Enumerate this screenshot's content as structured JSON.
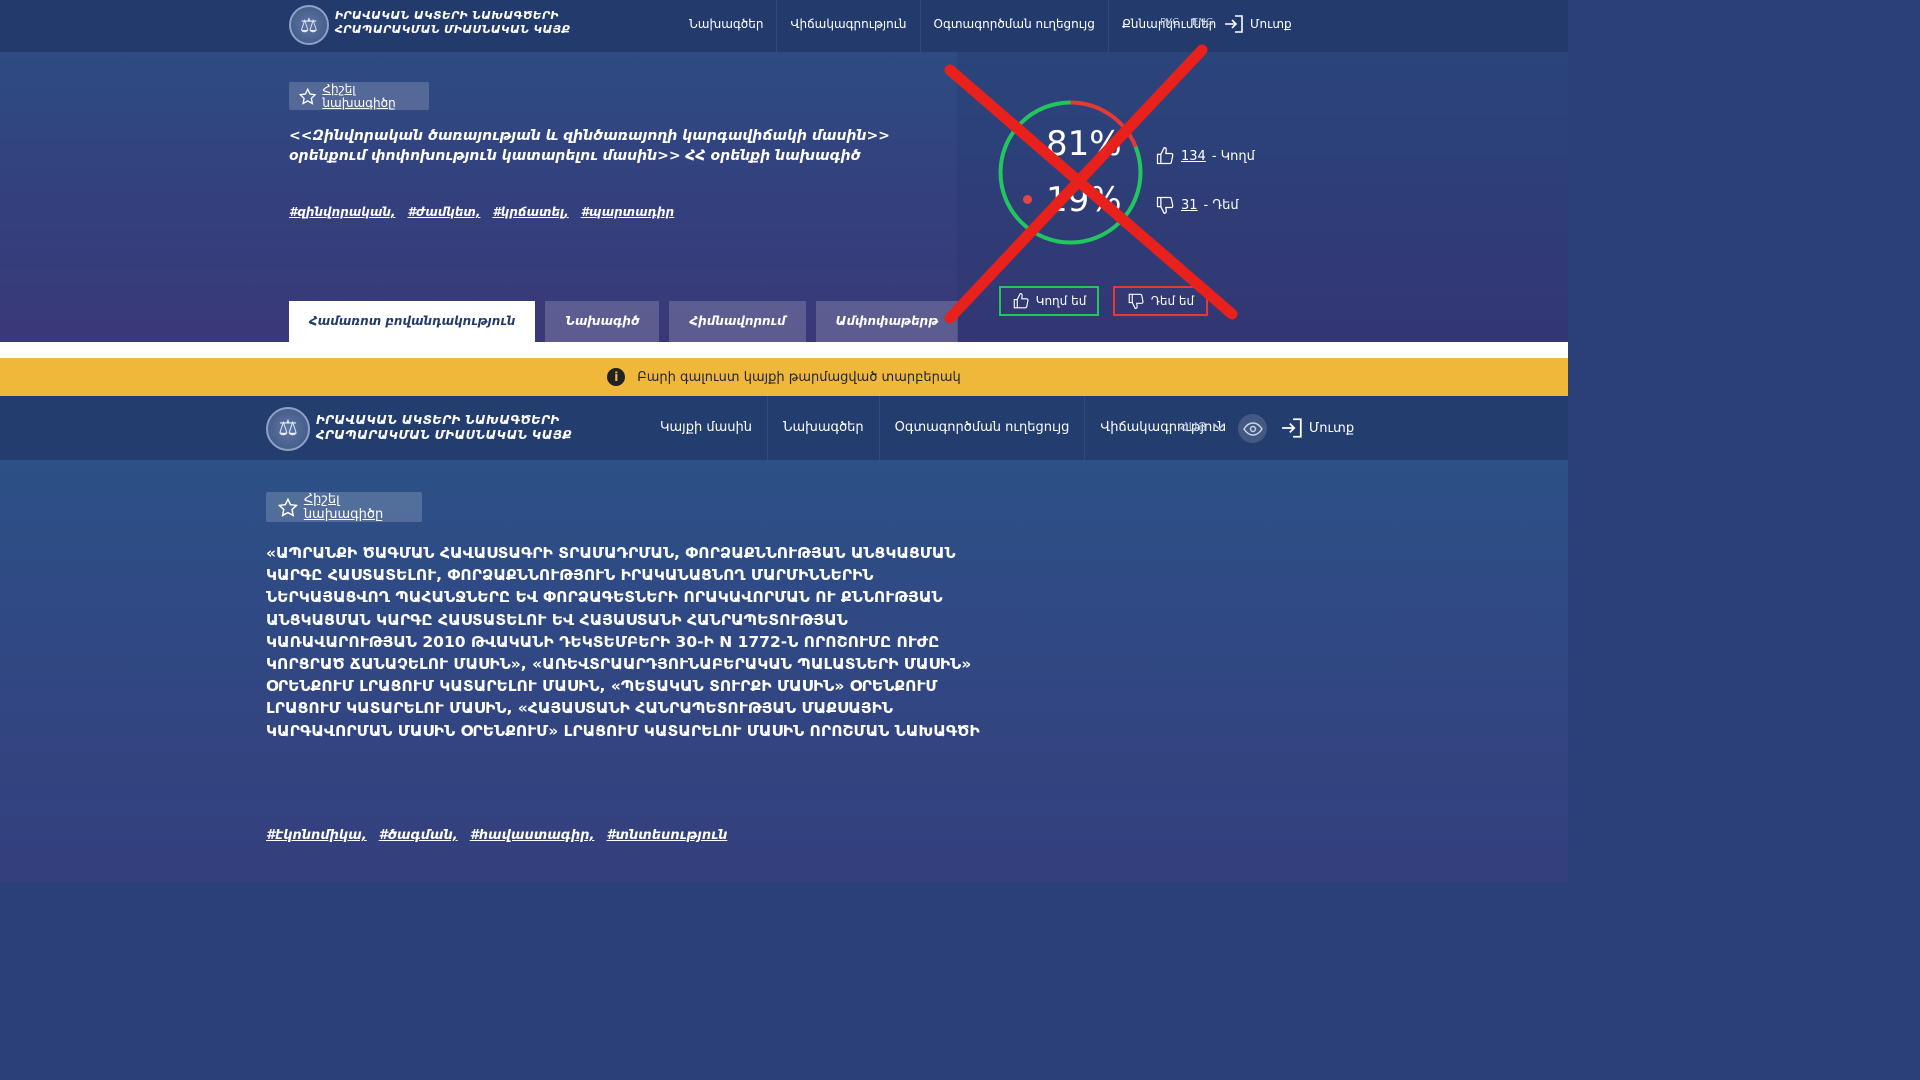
{
  "old": {
    "logo": {
      "line1": "ԻՐԱՎԱԿԱՆ ԱԿՏԵՐԻ ՆԱԽԱԳԾԵՐԻ",
      "line2": "ՀՐԱՊԱՐԱԿՄԱՆ ՄԻԱՍՆԱԿԱՆ ԿԱՅՔ"
    },
    "nav": [
      "Նախագծեր",
      "Վիճակագրություն",
      "Օգտագործման ուղեցույց",
      "Քննարկումներ"
    ],
    "lang": [
      "РУС",
      "ENG"
    ],
    "login": "Մուտք",
    "remember": "Հիշել նախագիծը",
    "title": "<<Զինվորական ծառայության և զինծառայողի կարգավիճակի մասին>> օրենքում փոփոխություն կատարելու մասին>> ՀՀ օրենքի նախագիծ",
    "tags": [
      "#զինվորական,",
      "#ժամկետ,",
      "#կրճատել,",
      "#պարտադիր"
    ],
    "tabs": [
      "Համառոտ բովանդակություն",
      "Նախագիծ",
      "Հիմնավորում",
      "Ամփոփաթերթ"
    ],
    "votes": {
      "yes_percent": "81%",
      "no_percent": "19%",
      "yes_fraction": 0.81,
      "no_fraction": 0.19,
      "yes_count": "134",
      "yes_label": "- Կողմ",
      "no_count": "31",
      "no_label": "- Դեմ",
      "for_button": "Կողմ եմ",
      "against_button": "Դեմ եմ"
    }
  },
  "banner": {
    "text": "Բարի գալուստ կայքի թարմացված տարբերակ",
    "icon": "info-icon"
  },
  "new": {
    "logo": {
      "line1": "ԻՐԱՎԱԿԱՆ ԱԿՏԵՐԻ ՆԱԽԱԳԾԵՐԻ",
      "line2": "ՀՐԱՊԱՐԱԿՄԱՆ ՄԻԱՍՆԱԿԱՆ ԿԱՅՔ"
    },
    "nav": [
      "Կայքի մասին",
      "Նախագծեր",
      "Օգտագործման ուղեցույց",
      "Վիճակագրություն"
    ],
    "lang": "ՀԱՅ",
    "login": "Մուտք",
    "remember": "Հիշել նախագիծը",
    "title": "«ԱՊՐԱՆՔԻ ԾԱԳՄԱՆ ՀԱՎԱՍՏԱԳՐԻ ՏՐԱՄԱԴՐՄԱՆ, ՓՈՐՁԱՔՆՆՈՒԹՅԱՆ ԱՆՑԿԱՑՄԱՆ ԿԱՐԳԸ ՀԱՍՏԱՏԵԼՈՒ, ՓՈՐՁԱՔՆՆՈՒԹՅՈՒՆ ԻՐԱԿԱՆԱՑՆՈՂ ՄԱՐՄԻՆՆԵՐԻՆ ՆԵՐԿԱՅԱՑՎՈՂ ՊԱՀԱՆՋՆԵՐԸ ԵՎ ՓՈՐՁԱԳԵՏՆԵՐԻ ՈՐԱԿԱՎՈՐՄԱՆ ՈՒ ՔՆՆՈՒԹՅԱՆ ԱՆՑԿԱՑՄԱՆ ԿԱՐԳԸ ՀԱՍՏԱՏԵԼՈՒ ԵՎ ՀԱՅԱՍՏԱՆԻ ՀԱՆՐԱՊԵՏՈՒԹՅԱՆ ԿԱՌԱՎԱՐՈՒԹՅԱՆ 2010 ԹՎԱԿԱՆԻ ԴԵԿՏԵՄԲԵՐԻ 30-Ի N 1772-Ն ՈՐՈՇՈՒՄԸ ՈՒԺԸ ԿՈՐՑՐԱԾ ՃԱՆԱՉԵԼՈՒ ՄԱՍԻՆ», «ԱՌԵՎՏՐԱԱՐԴՅՈՒՆԱԲԵՐԱԿԱՆ ՊԱԼԱՏՆԵՐԻ ՄԱՍԻՆ» ՕՐԵՆՔՈՒՄ ԼՐԱՑՈՒՄ ԿԱՏԱՐԵԼՈՒ ՄԱՍԻՆ, «ՊԵՏԱԿԱՆ ՏՈՒՐՔԻ ՄԱՍԻՆ» ՕՐԵՆՔՈՒՄ ԼՐԱՑՈՒՄ ԿԱՏԱՐԵԼՈՒ ՄԱՍԻՆ, «ՀԱՅԱՍՏԱՆԻ ՀԱՆՐԱՊԵՏՈՒԹՅԱՆ ՄԱՔՍԱՅԻՆ ԿԱՐԳԱՎՈՐՄԱՆ ՄԱՍԻՆ ՕՐԵՆՔՈՒՄ» ԼՐԱՑՈՒՄ ԿԱՏԱՐԵԼՈՒ ՄԱՍԻՆ ՈՐՈՇՄԱՆ ՆԱԽԱԳԾԻ",
    "tags": [
      "#էկոնոմիկա,",
      "#ծագման,",
      "#հավաստագիր,",
      "#տնտեսություն"
    ]
  },
  "colors": {
    "header": "#223a6c",
    "banner": "#f0b83a",
    "vote_yes": "#22c55e",
    "vote_no": "#e53935",
    "cross": "#e8211c"
  }
}
